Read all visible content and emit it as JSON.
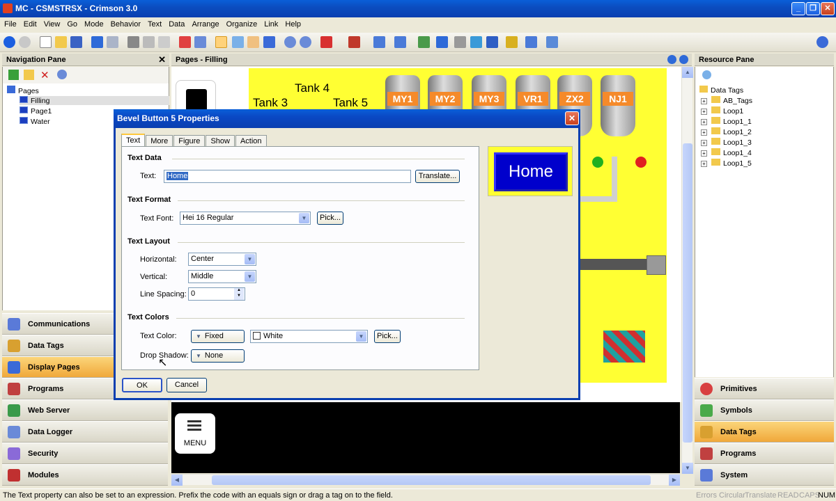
{
  "window": {
    "title": "MC - CSMSTRSX - Crimson 3.0"
  },
  "menu": [
    "File",
    "Edit",
    "View",
    "Go",
    "Mode",
    "Behavior",
    "Text",
    "Data",
    "Arrange",
    "Organize",
    "Link",
    "Help"
  ],
  "nav_pane": {
    "title": "Navigation Pane",
    "tree_root": "Pages",
    "tree_items": [
      "Filling",
      "Page1",
      "Water"
    ],
    "sections": [
      "Communications",
      "Data Tags",
      "Display Pages",
      "Programs",
      "Web Server",
      "Data Logger",
      "Security",
      "Modules"
    ],
    "active_section": "Display Pages"
  },
  "editor": {
    "title": "Pages - Filling",
    "tank_labels": [
      "Tank 4",
      "Tank 3",
      "Tank 5"
    ],
    "tank_tags": [
      "MY1",
      "MY2",
      "MY3",
      "VR1",
      "ZX2",
      "NJ1"
    ],
    "menu_button_label": "MENU"
  },
  "dialog": {
    "title": "Bevel Button 5 Properties",
    "tabs": [
      "Text",
      "More",
      "Figure",
      "Show",
      "Action"
    ],
    "active_tab": "Text",
    "text_data": {
      "heading": "Text Data",
      "text_label": "Text:",
      "text_value": "Home",
      "translate_button": "Translate..."
    },
    "text_format": {
      "heading": "Text Format",
      "font_label": "Text Font:",
      "font_value": "Hei 16 Regular",
      "pick_button": "Pick..."
    },
    "text_layout": {
      "heading": "Text Layout",
      "horizontal_label": "Horizontal:",
      "horizontal_value": "Center",
      "vertical_label": "Vertical:",
      "vertical_value": "Middle",
      "spacing_label": "Line Spacing:",
      "spacing_value": "0"
    },
    "text_colors": {
      "heading": "Text Colors",
      "color_label": "Text Color:",
      "color_mode": "Fixed",
      "color_value": "White",
      "pick_button": "Pick...",
      "shadow_label": "Drop Shadow:",
      "shadow_value": "None"
    },
    "preview_text": "Home",
    "ok_button": "OK",
    "cancel_button": "Cancel"
  },
  "resource_pane": {
    "title": "Resource Pane",
    "root": "Data Tags",
    "items": [
      "AB_Tags",
      "Loop1",
      "Loop1_1",
      "Loop1_2",
      "Loop1_3",
      "Loop1_4",
      "Loop1_5"
    ],
    "sections": [
      "Primitives",
      "Symbols",
      "Data Tags",
      "Programs",
      "System"
    ],
    "active_section": "Data Tags"
  },
  "status": {
    "message": "The Text property can also be set to an expression. Prefix the code with an equals sign or drag a tag on to the field.",
    "indicators": [
      "Errors",
      "Circular",
      "Translate",
      "READ",
      "CAPS",
      "NUM"
    ]
  },
  "colors": {
    "titlebar": "#0a48c4",
    "active_section": "#f0a83a",
    "canvas_yellow": "#ffff33",
    "preview_button": "#0000cc"
  }
}
